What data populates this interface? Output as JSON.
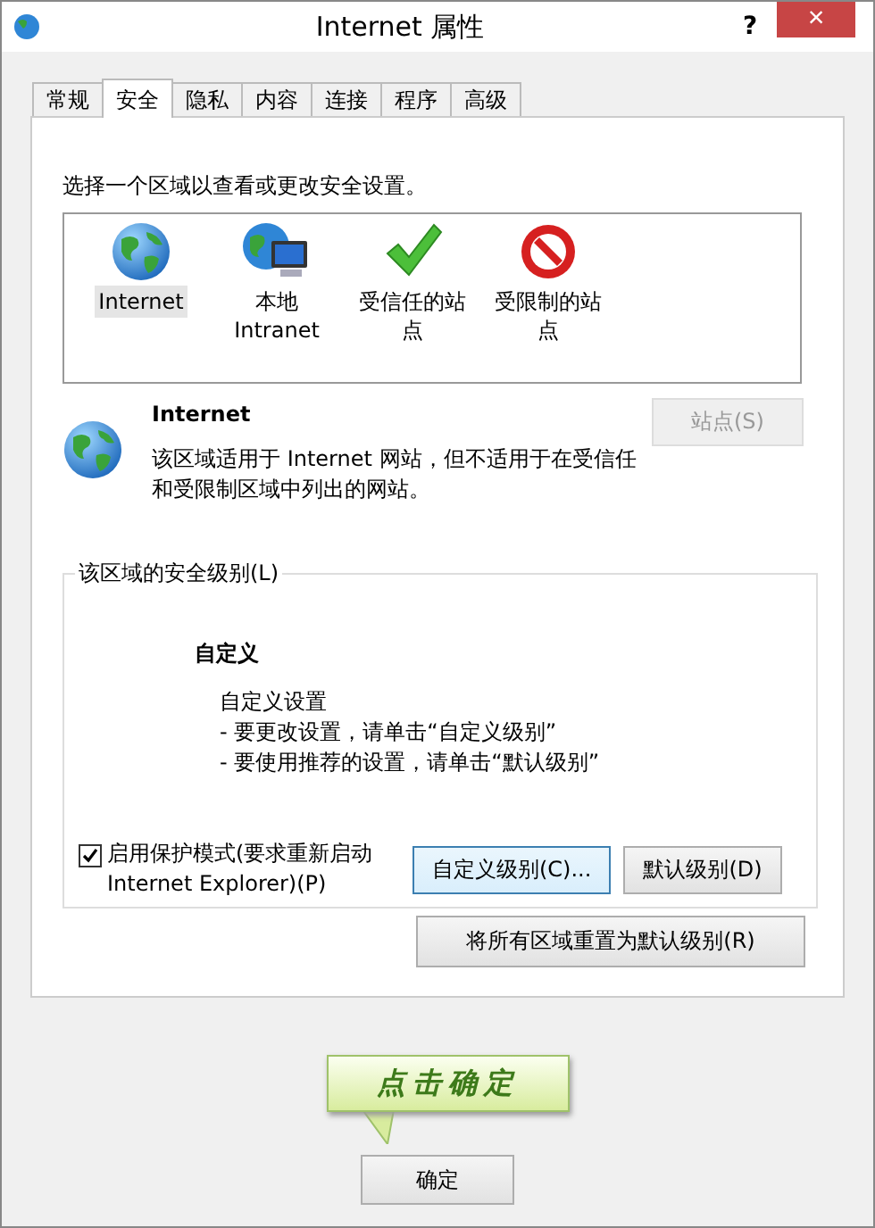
{
  "window": {
    "title": "Internet 属性",
    "help": "?",
    "close": "×"
  },
  "tabs": [
    {
      "label": "常规",
      "selected": false
    },
    {
      "label": "安全",
      "selected": true
    },
    {
      "label": "隐私",
      "selected": false
    },
    {
      "label": "内容",
      "selected": false
    },
    {
      "label": "连接",
      "selected": false
    },
    {
      "label": "程序",
      "selected": false
    },
    {
      "label": "高级",
      "selected": false
    }
  ],
  "zone_prompt": "选择一个区域以查看或更改安全设置。",
  "zones": [
    {
      "kind": "globe",
      "label": "Internet",
      "selected": true
    },
    {
      "kind": "intranet",
      "label": "本地 Intranet",
      "selected": false
    },
    {
      "kind": "trusted",
      "label": "受信任的站点",
      "selected": false
    },
    {
      "kind": "restricted",
      "label": "受限制的站点",
      "selected": false
    }
  ],
  "zone_info": {
    "title": "Internet",
    "description": "该区域适用于 Internet 网站，但不适用于在受信任和受限制区域中列出的网站。",
    "sites_button": {
      "label": "站点(S)",
      "disabled": true
    }
  },
  "security_level": {
    "legend": "该区域的安全级别(L)",
    "level_name": "自定义",
    "details": [
      "自定义设置",
      "- 要更改设置，请单击“自定义级别”",
      "- 要使用推荐的设置，请单击“默认级别”"
    ],
    "protected_mode": {
      "label": "启用保护模式(要求重新启动 Internet Explorer)(P)",
      "checked": true
    },
    "buttons": [
      {
        "label": "自定义级别(C)...",
        "focused": true
      },
      {
        "label": "默认级别(D)",
        "focused": false
      }
    ]
  },
  "reset_button": "将所有区域重置为默认级别(R)",
  "callout": "点击确定",
  "ok_button": "确定"
}
